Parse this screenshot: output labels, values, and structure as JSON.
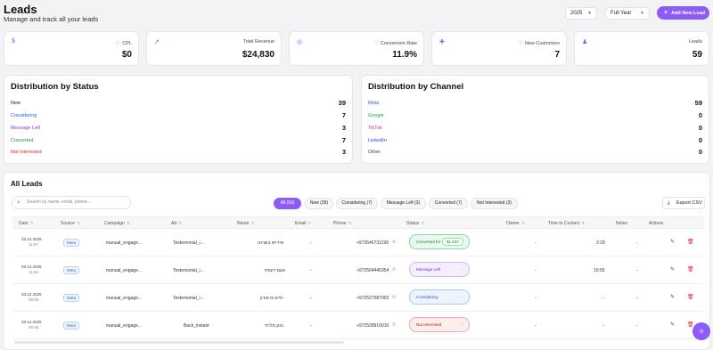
{
  "header": {
    "title": "Leads",
    "subtitle": "Manage and track all your leads",
    "year": "2025",
    "period": "Full Year",
    "add_button": "Add New Lead"
  },
  "stats": [
    {
      "label": "CPL",
      "value": "$0",
      "icon": "dollar-icon"
    },
    {
      "label": "Total Revenue",
      "value": "$24,830",
      "icon": "trend-icon"
    },
    {
      "label": "Conversion Rate",
      "value": "11.9%",
      "icon": "target-icon"
    },
    {
      "label": "New Customers",
      "value": "7",
      "icon": "user-plus-icon"
    },
    {
      "label": "Leads",
      "value": "59",
      "icon": "users-icon"
    }
  ],
  "status_distribution": {
    "title": "Distribution by Status",
    "rows": [
      {
        "label": "New",
        "value": "39",
        "color": "#222222"
      },
      {
        "label": "Considering",
        "value": "7",
        "color": "#2563eb"
      },
      {
        "label": "Message Left",
        "value": "3",
        "color": "#9333ea"
      },
      {
        "label": "Converted",
        "value": "7",
        "color": "#16a34a"
      },
      {
        "label": "Not Interested",
        "value": "3",
        "color": "#dc2626"
      }
    ]
  },
  "channel_distribution": {
    "title": "Distribution by Channel",
    "rows": [
      {
        "label": "Meta",
        "value": "59",
        "color": "#2563eb"
      },
      {
        "label": "Google",
        "value": "0",
        "color": "#16a34a"
      },
      {
        "label": "TikTok",
        "value": "0",
        "color": "#db2777"
      },
      {
        "label": "LinkedIn",
        "value": "0",
        "color": "#1d4ed8"
      },
      {
        "label": "Other",
        "value": "0",
        "color": "#444444"
      }
    ]
  },
  "all_leads": {
    "title": "All Leads",
    "search_placeholder": "Search by name, email, phone...",
    "filters": [
      "All (59)",
      "New (39)",
      "Considering (7)",
      "Message Left (3)",
      "Converted (7)",
      "Not Interested (3)"
    ],
    "export": "Export CSV",
    "columns": [
      "Date",
      "Source",
      "Campaign",
      "Ad",
      "Name",
      "Email",
      "Phone",
      "Status",
      "Owner",
      "Time to Contact",
      "Notes",
      "Actions"
    ],
    "rows": [
      {
        "date": "03.12.2025",
        "time": "11:57",
        "source": "Meta",
        "campaign": "manual_engage...",
        "ad": "Testemonial_i...",
        "name": "אידיתו בשרנה",
        "email": "-",
        "phone": "+972546731199",
        "status": "Converted for",
        "amount": "$1,600",
        "owner": "-",
        "ttc": "2:29",
        "notes": "-"
      },
      {
        "date": "03.12.2025",
        "time": "11:52",
        "source": "Meta",
        "campaign": "manual_engage...",
        "ad": "Testemonial_i...",
        "name": "נועם דעפת",
        "email": "-",
        "phone": "+972504440354",
        "status": "Message Left",
        "amount": "",
        "owner": "-",
        "ttc": "10:55",
        "notes": "-"
      },
      {
        "date": "03.12.2025",
        "time": "09:58",
        "source": "Meta",
        "campaign": "manual_engage...",
        "ad": "Testemonial_i...",
        "name": "חיים גז אורון",
        "email": "-",
        "phone": "+972527587902",
        "status": "Considering",
        "amount": "",
        "owner": "-",
        "ttc": "-",
        "notes": "-"
      },
      {
        "date": "03.12.2025",
        "time": "00:48",
        "source": "Meta",
        "campaign": "manual_engage...",
        "ad": "Back_instant",
        "name": "בוגן מליחי",
        "email": "-",
        "phone": "+972528910010",
        "status": "Not Interested",
        "amount": "",
        "owner": "-",
        "ttc": "-",
        "notes": "-"
      }
    ]
  }
}
